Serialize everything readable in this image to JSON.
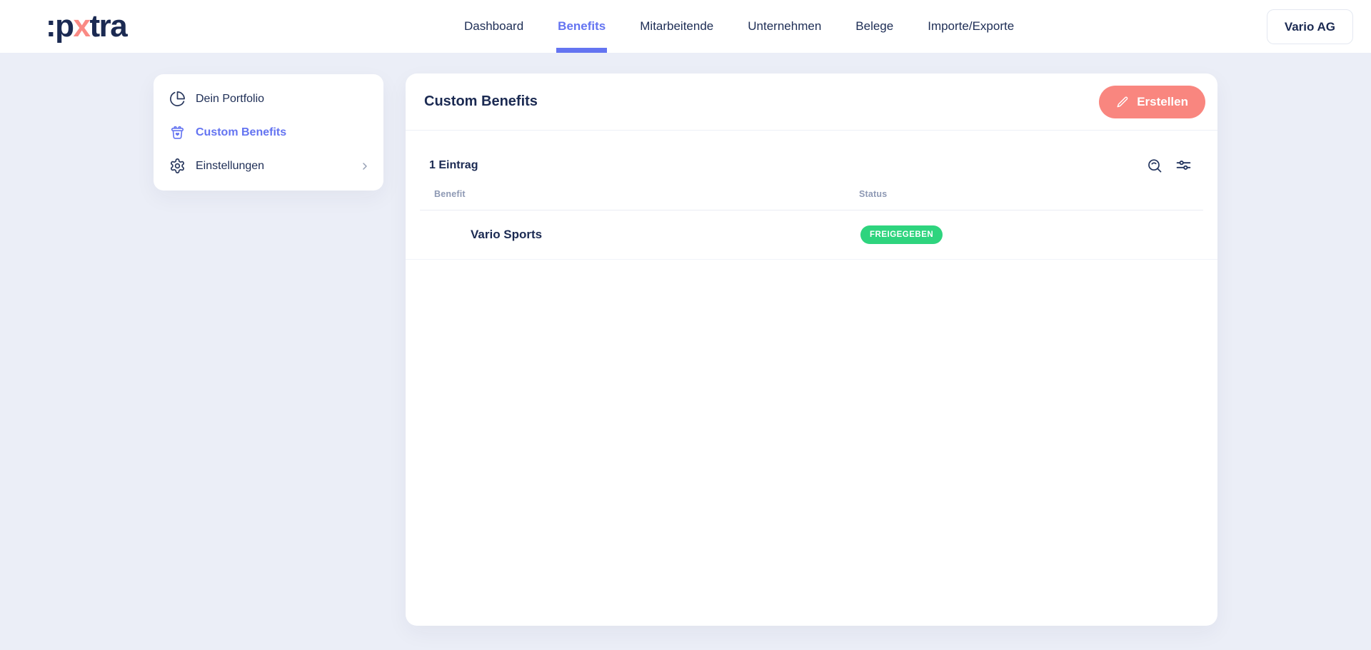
{
  "brand": {
    "logo": {
      "part1": ":p",
      "part2": "x",
      "part3": "tra"
    }
  },
  "nav": {
    "items": [
      {
        "label": "Dashboard",
        "active": false
      },
      {
        "label": "Benefits",
        "active": true
      },
      {
        "label": "Mitarbeitende",
        "active": false
      },
      {
        "label": "Unternehmen",
        "active": false
      },
      {
        "label": "Belege",
        "active": false
      },
      {
        "label": "Importe/Exporte",
        "active": false
      }
    ],
    "account_label": "Vario AG"
  },
  "sidebar": {
    "items": [
      {
        "label": "Dein Portfolio",
        "icon": "pie-chart-icon",
        "active": false
      },
      {
        "label": "Custom Benefits",
        "icon": "benefits-basket-icon",
        "active": true
      },
      {
        "label": "Einstellungen",
        "icon": "gear-icon",
        "active": false,
        "has_chevron": true
      }
    ]
  },
  "main": {
    "title": "Custom Benefits",
    "create_button_label": "Erstellen",
    "entry_count": "1 Eintrag",
    "toolbar_icons": [
      "search-icon",
      "filter-sliders-icon"
    ],
    "table": {
      "columns": [
        "Benefit",
        "Status"
      ],
      "rows": [
        {
          "benefit": "Vario Sports",
          "icon": "sneaker-icon",
          "status": "FREIGEGEBEN"
        }
      ]
    }
  },
  "colors": {
    "accent_blue": "#6474f1",
    "salmon": "#f9867f",
    "navy": "#1b2a52",
    "badge_green": "#2ed47e",
    "background": "#ebeef7",
    "muted_header_text": "#8e99b4"
  }
}
